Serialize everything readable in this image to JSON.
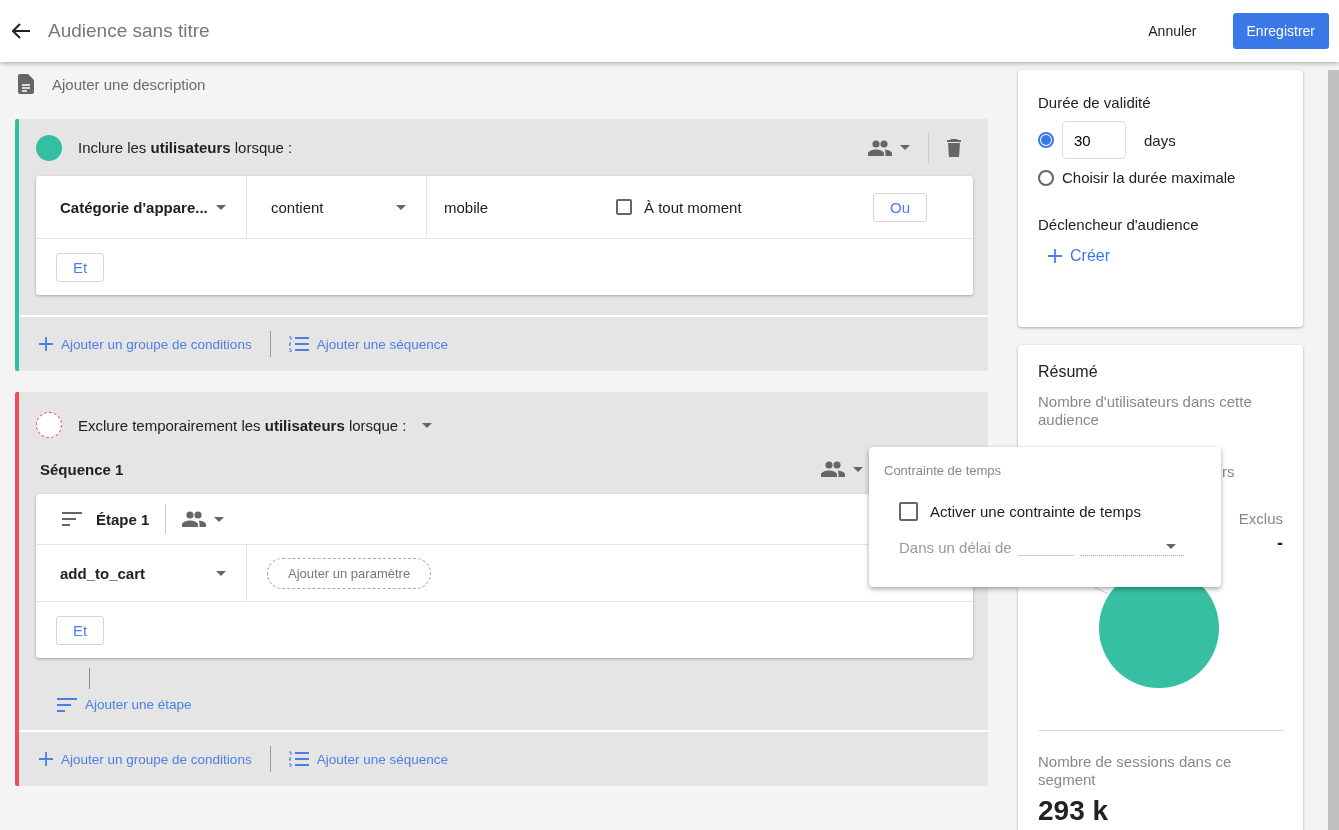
{
  "header": {
    "title": "Audience sans titre",
    "cancel": "Annuler",
    "save": "Enregistrer"
  },
  "description": {
    "placeholder": "Ajouter une description"
  },
  "include_group": {
    "heading": "Inclure les **utilisateurs** lorsque :",
    "condition": {
      "dimension": "Catégorie d'appare...",
      "operator": "contient",
      "value": "mobile",
      "any_time": {
        "label": "À tout moment",
        "checked": false
      },
      "or_button": "Ou"
    },
    "and_button": "Et",
    "footer_links": [
      "Ajouter un groupe de conditions",
      "Ajouter une séquence"
    ]
  },
  "exclude_group": {
    "heading": "Exclure temporairement les **utilisateurs** lorsque :",
    "sequence": {
      "title": "Séquence 1",
      "step": {
        "title": "Étape 1",
        "event": "add_to_cart",
        "add_parameter": "Ajouter un paramètre",
        "and_button": "Et"
      },
      "add_step": "Ajouter une étape"
    },
    "footer_links": [
      "Ajouter un groupe de conditions",
      "Ajouter une séquence"
    ]
  },
  "settings": {
    "validity_title": "Durée de validité",
    "options": [
      {
        "kind": "days",
        "value": "30",
        "unit": "days",
        "selected": true
      },
      {
        "kind": "label",
        "label": "Choisir la durée maximale",
        "selected": false
      }
    ],
    "trigger_title": "Déclencheur d'audience",
    "create": "Créer"
  },
  "summary": {
    "title": "Résumé",
    "users_label": "Nombre d'utilisateurs dans cette audience",
    "partial_label": "rs",
    "excluded_label": "Exclus",
    "excluded_value": "-",
    "sessions_label": "Nombre de sessions dans ce segment",
    "sessions_value": "293 k"
  },
  "time_constraint_popup": {
    "title": "Contrainte de temps",
    "enable": {
      "label": "Activer une contrainte de temps",
      "checked": false
    },
    "within_label": "Dans un délai de"
  }
}
